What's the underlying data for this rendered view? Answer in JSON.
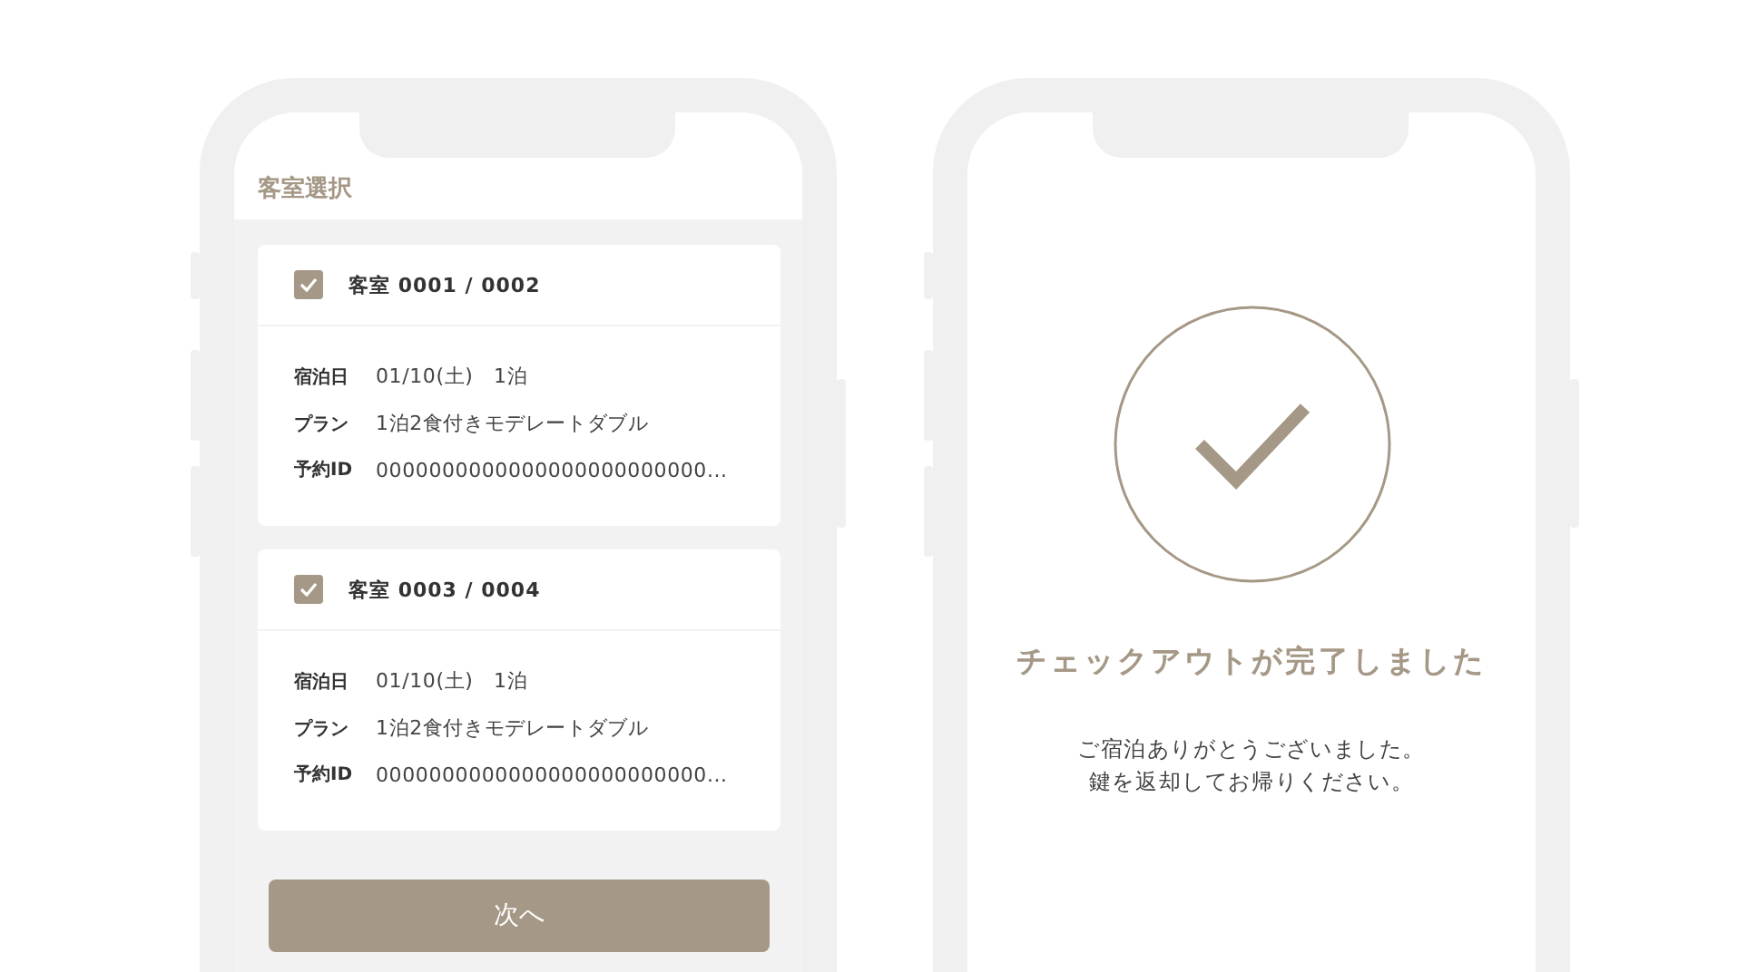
{
  "room_select": {
    "title": "客室選択",
    "rooms": [
      {
        "checked": true,
        "name": "客室 0001 / 0002",
        "details": [
          {
            "label": "宿泊日",
            "value": "01/10(土)　1泊"
          },
          {
            "label": "プラン",
            "value": "1泊2食付きモデレートダブル"
          },
          {
            "label": "予約ID",
            "value": "0000000000000000000000000..."
          }
        ]
      },
      {
        "checked": true,
        "name": "客室 0003 / 0004",
        "details": [
          {
            "label": "宿泊日",
            "value": "01/10(土)　1泊"
          },
          {
            "label": "プラン",
            "value": "1泊2食付きモデレートダブル"
          },
          {
            "label": "予約ID",
            "value": "0000000000000000000000000..."
          }
        ]
      }
    ],
    "next_button": "次へ"
  },
  "checkout_complete": {
    "title": "チェックアウトが完了しました",
    "message_lines": [
      "ご宿泊ありがとうございました。",
      "鍵を返却してお帰りください。"
    ]
  }
}
